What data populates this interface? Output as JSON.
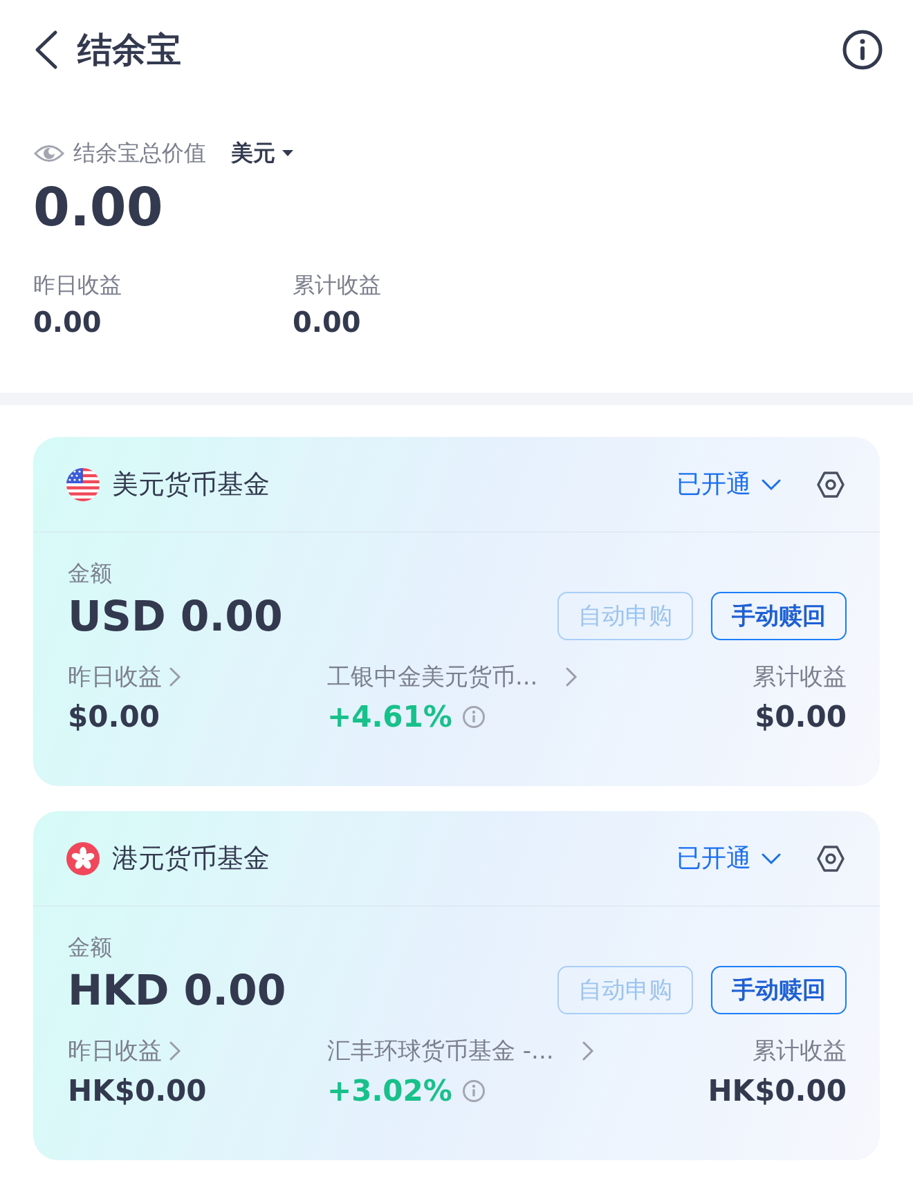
{
  "header": {
    "title": "结余宝"
  },
  "summary": {
    "label": "结余宝总价值",
    "currency": "美元",
    "total": "0.00",
    "stats": [
      {
        "label": "昨日收益",
        "value": "0.00"
      },
      {
        "label": "累计收益",
        "value": "0.00"
      }
    ]
  },
  "funds": [
    {
      "kind": "us",
      "name": "美元货币基金",
      "status": "已开通",
      "amount_label": "金额",
      "amount": "USD 0.00",
      "buttons": [
        {
          "label": "自动申购",
          "disabled": true
        },
        {
          "label": "手动赎回",
          "disabled": false
        }
      ],
      "yesterday_label": "昨日收益",
      "yesterday": "$0.00",
      "product": "工银中金美元货币...",
      "rate": "+4.61%",
      "total_label": "累计收益",
      "total": "$0.00"
    },
    {
      "kind": "hk",
      "name": "港元货币基金",
      "status": "已开通",
      "amount_label": "金额",
      "amount": "HKD 0.00",
      "buttons": [
        {
          "label": "自动申购",
          "disabled": true
        },
        {
          "label": "手动赎回",
          "disabled": false
        }
      ],
      "yesterday_label": "昨日收益",
      "yesterday": "HK$0.00",
      "product": "汇丰环球货币基金 -...",
      "rate": "+3.02%",
      "total_label": "累计收益",
      "total": "HK$0.00"
    }
  ]
}
